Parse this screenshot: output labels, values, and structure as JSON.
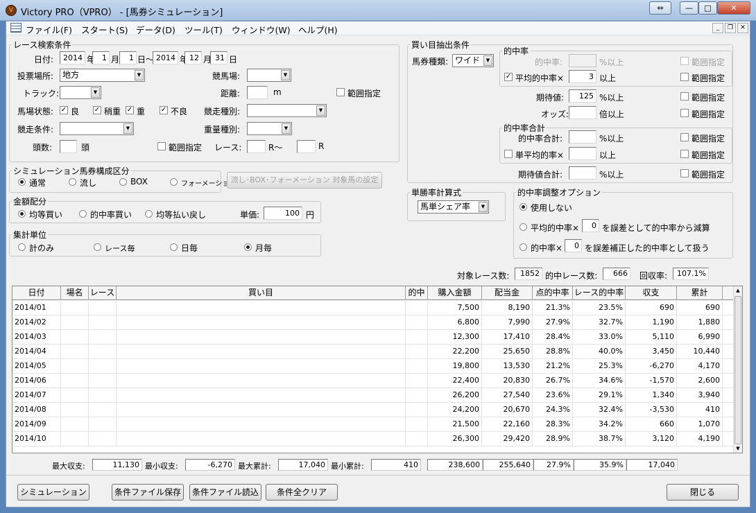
{
  "window": {
    "title": "Victory PRO（VPRO） - [馬券シミュレーション]",
    "app_icon": "victory-app-icon"
  },
  "menu": [
    "ファイル(F)",
    "スタート(S)",
    "データ(D)",
    "ツール(T)",
    "ウィンドウ(W)",
    "ヘルプ(H)"
  ],
  "race": {
    "legend": "レース検索条件",
    "date_label": "日付:",
    "date_from": [
      "2014",
      "1",
      "1"
    ],
    "date_to": [
      "2014",
      "12",
      "31"
    ],
    "y": "年",
    "m": "月",
    "d": "日",
    "tilde": "日～",
    "venue_label": "投票場所:",
    "venue_value": "地方",
    "track_label": "競馬場:",
    "trackcond_label": "トラック:",
    "distance_label": "距離:",
    "distance_unit": "m",
    "range_label": "範囲指定",
    "baba_label": "馬場状態:",
    "baba": [
      "良",
      "稍重",
      "重",
      "不良"
    ],
    "shubetsu_label": "競走種別:",
    "joken_label": "競走条件:",
    "juryo_label": "重量種別:",
    "tosu_label": "頭数:",
    "tosu_unit": "頭",
    "race_label": "レース:",
    "race_from_unit": "R～",
    "race_to_unit": "R"
  },
  "sim": {
    "legend": "シミュレーション馬券構成区分",
    "options": [
      "通常",
      "流し",
      "BOX",
      "フォーメーション"
    ],
    "selected": 0,
    "button": "流し･BOX･フォーメーション 対象馬の設定"
  },
  "alloc": {
    "legend": "金額配分",
    "options": [
      "均等買い",
      "的中率買い",
      "均等払い戻し"
    ],
    "selected": 0,
    "price_label": "単価:",
    "price_value": "100",
    "price_unit": "円"
  },
  "unit": {
    "legend": "集計単位",
    "options": [
      "計のみ",
      "レース毎",
      "日毎",
      "月毎"
    ],
    "selected": 3
  },
  "kaime": {
    "legend": "買い目抽出条件",
    "type_label": "馬券種類:",
    "type_value": "ワイド"
  },
  "hit": {
    "legend": "的中率",
    "rate_label": "的中率:",
    "rate_unit": "%以上",
    "avg_label": "平均的中率×",
    "avg_value": "3",
    "avg_unit": "以上",
    "range_label": "範囲指定"
  },
  "kitai": {
    "label": "期待値:",
    "value": "125",
    "unit": "%以上"
  },
  "odds": {
    "label": "オッズ:",
    "unit": "倍以上"
  },
  "hitsum": {
    "legend": "的中率合計",
    "sum_label": "的中率合計:",
    "sum_unit": "%以上",
    "avg_label": "単平均的率×",
    "avg_unit": "以上"
  },
  "kitaisum": {
    "label": "期待値合計:",
    "unit": "%以上"
  },
  "tansho": {
    "legend": "単勝率計算式",
    "value": "馬単シェア率"
  },
  "adjust": {
    "legend": "的中率調整オプション",
    "opt1": "使用しない",
    "opt2_prefix": "平均的中率×",
    "opt2_value": "0",
    "opt2_suffix": "を誤差として的中率から減算",
    "opt3_prefix": "的中率×",
    "opt3_value": "0",
    "opt3_suffix": "を誤差補正した的中率として扱う",
    "selected": 0
  },
  "stats": {
    "target_label": "対象レース数:",
    "target": "1852",
    "hit_label": "的中レース数:",
    "hit": "666",
    "recovery_label": "回収率:",
    "recovery": "107.1%"
  },
  "table": {
    "columns": [
      "日付",
      "場名",
      "レース",
      "買い目",
      "的中",
      "購入金額",
      "配当金",
      "点的中率",
      "レース的中率",
      "収支",
      "累計"
    ],
    "rows": [
      [
        "2014/01",
        "",
        "",
        "",
        "",
        "7,500",
        "8,190",
        "21.3%",
        "23.5%",
        "690",
        "690"
      ],
      [
        "2014/02",
        "",
        "",
        "",
        "",
        "6,800",
        "7,990",
        "27.9%",
        "32.7%",
        "1,190",
        "1,880"
      ],
      [
        "2014/03",
        "",
        "",
        "",
        "",
        "12,300",
        "17,410",
        "28.4%",
        "33.0%",
        "5,110",
        "6,990"
      ],
      [
        "2014/04",
        "",
        "",
        "",
        "",
        "22,200",
        "25,650",
        "28.8%",
        "40.0%",
        "3,450",
        "10,440"
      ],
      [
        "2014/05",
        "",
        "",
        "",
        "",
        "19,800",
        "13,530",
        "21.2%",
        "25.3%",
        "-6,270",
        "4,170"
      ],
      [
        "2014/06",
        "",
        "",
        "",
        "",
        "22,400",
        "20,830",
        "26.7%",
        "34.6%",
        "-1,570",
        "2,600"
      ],
      [
        "2014/07",
        "",
        "",
        "",
        "",
        "26,200",
        "27,540",
        "23.6%",
        "29.1%",
        "1,340",
        "3,940"
      ],
      [
        "2014/08",
        "",
        "",
        "",
        "",
        "24,200",
        "20,670",
        "24.3%",
        "32.4%",
        "-3,530",
        "410"
      ],
      [
        "2014/09",
        "",
        "",
        "",
        "",
        "21,500",
        "22,160",
        "28.3%",
        "34.2%",
        "660",
        "1,070"
      ],
      [
        "2014/10",
        "",
        "",
        "",
        "",
        "26,300",
        "29,420",
        "28.9%",
        "38.7%",
        "3,120",
        "4,190"
      ]
    ]
  },
  "totals": {
    "max_income_label": "最大収支:",
    "max_income": "11,130",
    "min_income_label": "最小収支:",
    "min_income": "-6,270",
    "max_cum_label": "最大累計:",
    "max_cum": "17,040",
    "min_cum_label": "最小累計:",
    "min_cum": "410",
    "buy": "238,600",
    "payout": "255,640",
    "point_rate": "27.9%",
    "race_rate": "35.9%",
    "income": "17,040"
  },
  "buttons": {
    "simulate": "シミュレーション",
    "save": "条件ファイル保存",
    "load": "条件ファイル読込",
    "clear": "条件全クリア",
    "close": "閉じる"
  }
}
